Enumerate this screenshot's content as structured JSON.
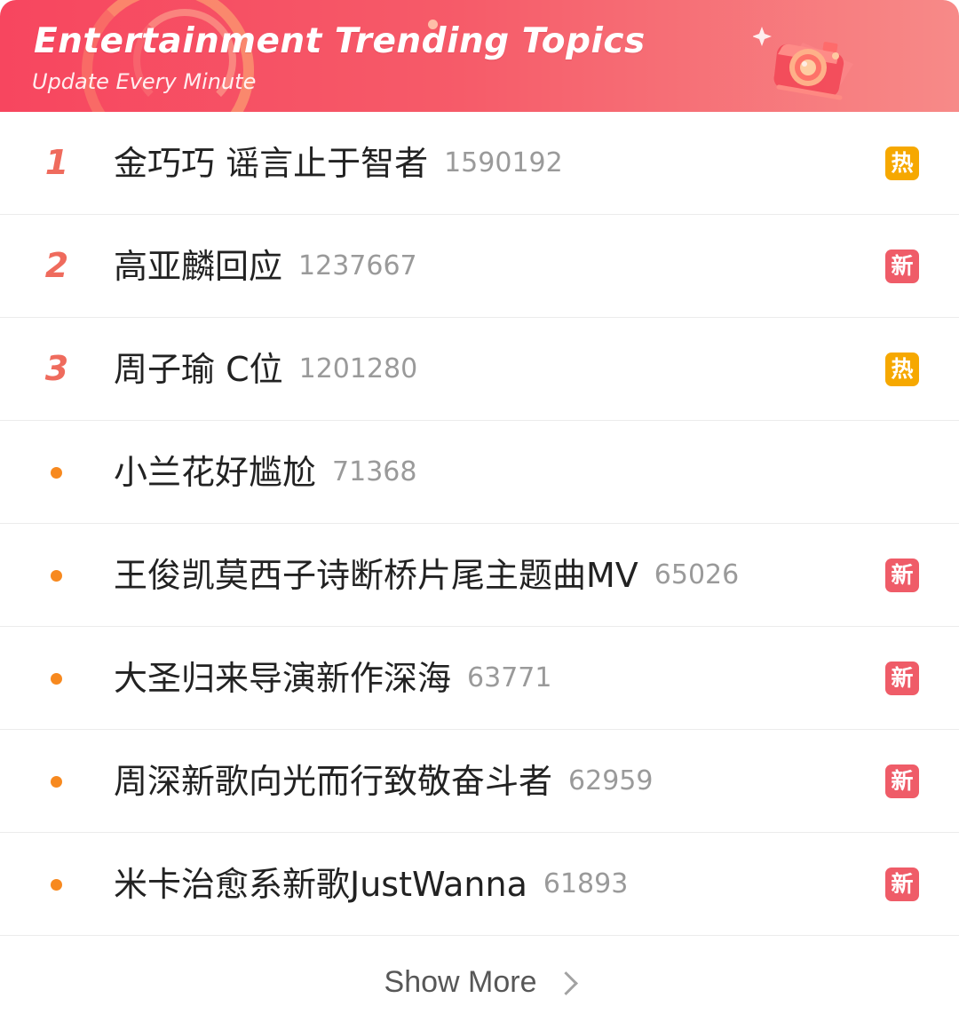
{
  "header": {
    "title": "Entertainment Trending Topics",
    "subtitle": "Update Every Minute",
    "gradient_colors": [
      "#f7465f",
      "#f65b69",
      "#f78a88"
    ],
    "icon": "camera-icon"
  },
  "trending": {
    "items": [
      {
        "rank": "1",
        "rank_type": "number",
        "topic": "金巧巧 谣言止于智者",
        "count": "1590192",
        "badge": "热",
        "badge_type": "hot"
      },
      {
        "rank": "2",
        "rank_type": "number",
        "topic": "高亚麟回应",
        "count": "1237667",
        "badge": "新",
        "badge_type": "new"
      },
      {
        "rank": "3",
        "rank_type": "number",
        "topic": "周子瑜 C位",
        "count": "1201280",
        "badge": "热",
        "badge_type": "hot"
      },
      {
        "rank": "",
        "rank_type": "dot",
        "topic": "小兰花好尴尬",
        "count": "71368",
        "badge": "",
        "badge_type": "none"
      },
      {
        "rank": "",
        "rank_type": "dot",
        "topic": "王俊凯莫西子诗断桥片尾主题曲MV",
        "count": "65026",
        "badge": "新",
        "badge_type": "new"
      },
      {
        "rank": "",
        "rank_type": "dot",
        "topic": "大圣归来导演新作深海",
        "count": "63771",
        "badge": "新",
        "badge_type": "new"
      },
      {
        "rank": "",
        "rank_type": "dot",
        "topic": "周深新歌向光而行致敬奋斗者",
        "count": "62959",
        "badge": "新",
        "badge_type": "new"
      },
      {
        "rank": "",
        "rank_type": "dot",
        "topic": "米卡治愈系新歌JustWanna",
        "count": "61893",
        "badge": "新",
        "badge_type": "new"
      }
    ]
  },
  "footer": {
    "show_more": "Show More",
    "icon": "chevron-right-icon"
  },
  "colors": {
    "rank": "#ef6b5d",
    "dot": "#f7891f",
    "hot_badge": "#f6a800",
    "new_badge": "#ef5c68",
    "topic_text": "#222222",
    "count_text": "#9a9a9a"
  }
}
